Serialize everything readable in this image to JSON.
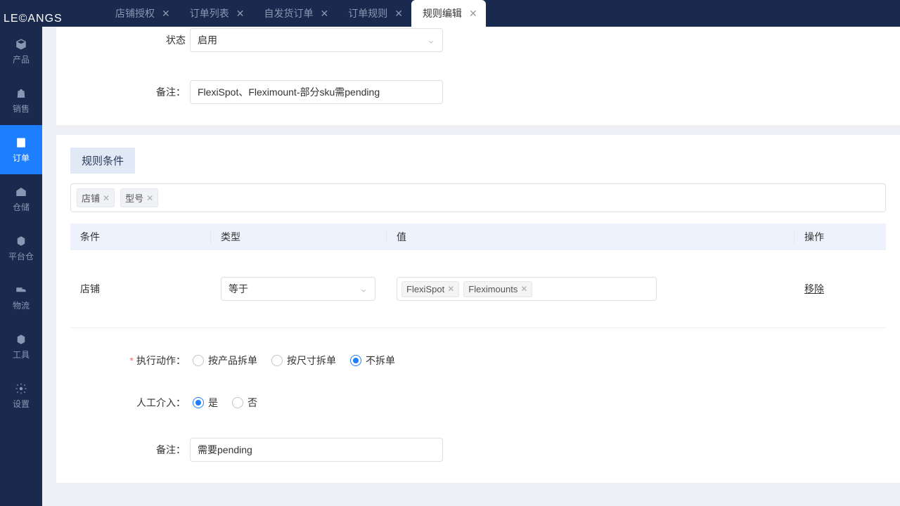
{
  "logo": "LE©ANGS",
  "sidebar": {
    "items": [
      {
        "label": "产品"
      },
      {
        "label": "销售"
      },
      {
        "label": "订单"
      },
      {
        "label": "仓储"
      },
      {
        "label": "平台仓"
      },
      {
        "label": "物流"
      },
      {
        "label": "工具"
      },
      {
        "label": "设置"
      }
    ]
  },
  "tabs": [
    {
      "label": "店铺授权"
    },
    {
      "label": "订单列表"
    },
    {
      "label": "自发货订单"
    },
    {
      "label": "订单规则"
    },
    {
      "label": "规则编辑"
    }
  ],
  "form1": {
    "status_label": "状态",
    "status_value": "启用",
    "remark_label": "备注：",
    "remark_value": "FlexiSpot、Fleximount-部分sku需pending"
  },
  "section1": {
    "title": "规则条件",
    "filter_tags": [
      "店铺",
      "型号"
    ],
    "table": {
      "headers": [
        "条件",
        "类型",
        "值",
        "操作"
      ],
      "rows": [
        {
          "condition": "店铺",
          "type": "等于",
          "values": [
            "FlexiSpot",
            "Fleximounts"
          ],
          "action": "移除"
        }
      ]
    }
  },
  "section2": {
    "exec_label": "执行动作：",
    "exec_options": [
      "按产品拆单",
      "按尺寸拆单",
      "不拆单"
    ],
    "manual_label": "人工介入：",
    "manual_options": [
      "是",
      "否"
    ],
    "remark_label": "备注：",
    "remark_value": "需要pending"
  }
}
